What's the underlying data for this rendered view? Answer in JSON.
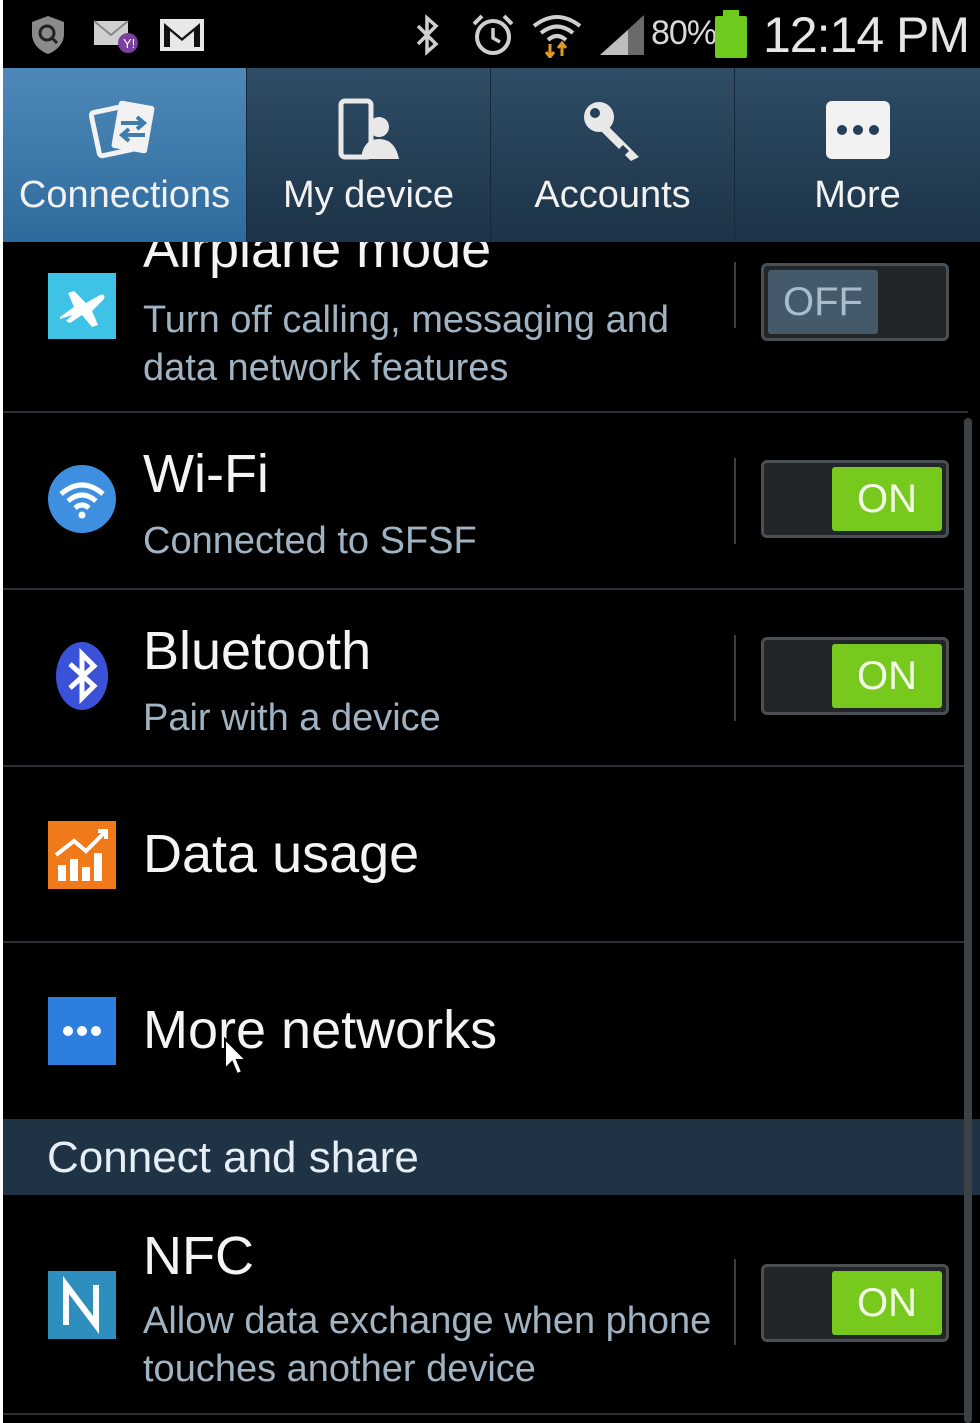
{
  "status_bar": {
    "icons": [
      "security-icon",
      "yahoo-mail-icon",
      "gmail-icon",
      "bluetooth-icon",
      "alarm-icon",
      "wifi-icon",
      "signal-icon"
    ],
    "battery_percent": "80%",
    "time": "12:14 PM",
    "battery_color": "#6ecb1e"
  },
  "tabs": [
    {
      "label": "Connections",
      "icon": "connections-icon",
      "active": true
    },
    {
      "label": "My device",
      "icon": "my-device-icon",
      "active": false
    },
    {
      "label": "Accounts",
      "icon": "accounts-key-icon",
      "active": false
    },
    {
      "label": "More",
      "icon": "more-dots-icon",
      "active": false
    }
  ],
  "settings": {
    "airplane": {
      "title": "Airplane mode",
      "subtitle": "Turn off calling, messaging and data network features",
      "toggle": "OFF"
    },
    "wifi": {
      "title": "Wi-Fi",
      "subtitle": "Connected to SFSF",
      "toggle": "ON"
    },
    "bluetooth": {
      "title": "Bluetooth",
      "subtitle": "Pair with a device",
      "toggle": "ON"
    },
    "data_usage": {
      "title": "Data usage"
    },
    "more_networks": {
      "title": "More networks"
    },
    "section_header": "Connect and share",
    "nfc": {
      "title": "NFC",
      "subtitle": "Allow data exchange when phone touches another device",
      "toggle": "ON"
    }
  },
  "colors": {
    "accent_on": "#77c91e",
    "tab_active": "#3f7dae",
    "tab_inactive": "#24405a",
    "subtitle_text": "#9fb3c2"
  }
}
